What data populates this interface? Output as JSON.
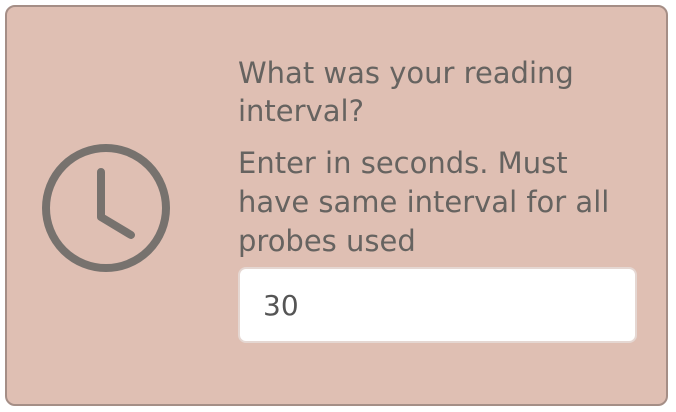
{
  "question": {
    "text": "What was your reading interval?"
  },
  "hint": {
    "text": "Enter in seconds. Must have same interval for all probes used"
  },
  "interval_input": {
    "value": "30",
    "placeholder": ""
  },
  "icon": {
    "name": "clock-icon",
    "color": "#77726e"
  },
  "colors": {
    "card_background": "#dfbfb3",
    "card_border": "#a58e86",
    "text": "#666360",
    "input_background": "#ffffff"
  }
}
